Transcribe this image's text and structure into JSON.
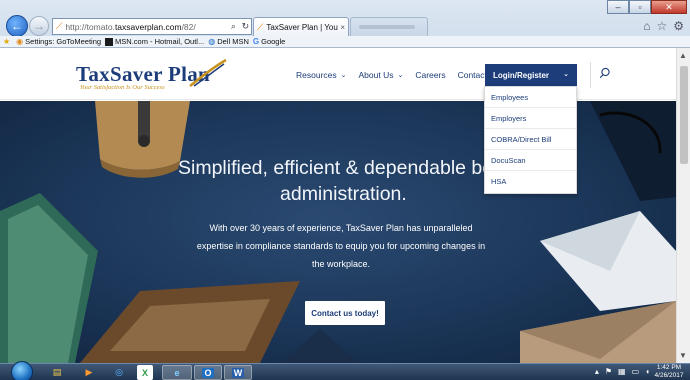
{
  "browser": {
    "address_url_prefix": "http://tomato.",
    "address_url_domain": "taxsaverplan.com",
    "address_url_suffix": "/82/",
    "address_search_icon": "search-icon",
    "address_refresh_icon": "refresh-icon",
    "active_tab_title": "TaxSaver Plan | Your satisfa...",
    "tab_close": "×",
    "tools": [
      "home-icon",
      "star-icon",
      "gear-icon"
    ],
    "window_controls": [
      "minimize",
      "maximize",
      "close"
    ]
  },
  "favorites": [
    {
      "label": "Settings: GoToMeeting",
      "icon": "settings-icon"
    },
    {
      "label": "MSN.com - Hotmail, Outl...",
      "icon": "msn-icon"
    },
    {
      "label": "Dell MSN",
      "icon": "dell-icon"
    },
    {
      "label": "Google",
      "icon": "google-icon"
    }
  ],
  "site": {
    "logo_name": "TaxSaver Plan",
    "logo_tagline": "Your Satisfaction Is Our Success",
    "nav": [
      {
        "label": "Resources",
        "has_dropdown": true
      },
      {
        "label": "About Us",
        "has_dropdown": true
      },
      {
        "label": "Careers",
        "has_dropdown": false
      },
      {
        "label": "Contact Us",
        "has_dropdown": false
      }
    ],
    "login_label": "Login/Register",
    "login_dropdown": [
      "Employees",
      "Employers",
      "COBRA/Direct Bill",
      "DocuScan",
      "HSA"
    ],
    "hero_heading_line1": "Simplified, efficient & dependable bene",
    "hero_heading_line2": "administration.",
    "hero_paragraph": "With over 30 years of experience, TaxSaver Plan has unparalleled expertise in compliance standards to equip you for upcoming changes in the workplace.",
    "cta_label": "Contact us today!",
    "brand_color": "#1c3d79",
    "accent_color": "#c8921d"
  },
  "taskbar": {
    "apps": [
      "explorer",
      "media-player",
      "outlook-web",
      "excel",
      "internet-explorer",
      "outlook",
      "word"
    ],
    "time": "1:42 PM",
    "date": "4/26/2017"
  }
}
